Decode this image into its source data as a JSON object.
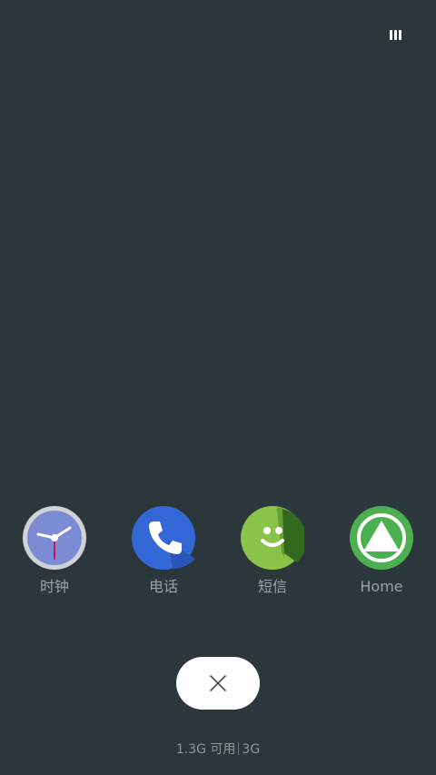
{
  "recents": {
    "apps": [
      {
        "label": "时钟",
        "icon": "clock-icon"
      },
      {
        "label": "电话",
        "icon": "phone-icon"
      },
      {
        "label": "短信",
        "icon": "messages-icon"
      },
      {
        "label": "Home",
        "icon": "home-triangle-icon"
      }
    ],
    "close_icon": "close-icon"
  },
  "memory": {
    "available": "1.3G 可用",
    "total": "3G"
  },
  "top_right_icon": "grid-view-icon",
  "colors": {
    "background": "#2b373b",
    "clock_face": "#7b8bd4",
    "phone": "#3367d6",
    "messages": "#8bc34a",
    "home": "#4caf50"
  }
}
